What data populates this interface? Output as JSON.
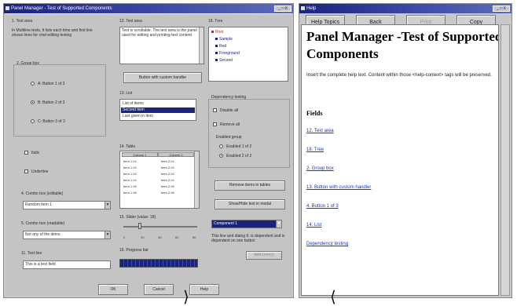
{
  "panel": {
    "title": "Panel Manager - Test of Supported Components",
    "controls": "_ □ X",
    "text_area_label": "1. Text area",
    "text_area_value": "In Multiline tests. It lists each time and first line shows lines for cmd editing testing",
    "groupbox_label": "2. Group box",
    "radios": [
      {
        "label": "A: Button 1 of 3",
        "selected": false
      },
      {
        "label": "B: Button 2 of 3",
        "selected": true
      },
      {
        "label": "C: Button 3 of 3",
        "selected": false
      }
    ],
    "check_italic": "Italic",
    "check_underline": "Underline",
    "combo_a_label": "4. Combo box (editable)",
    "combo_a_value": "Random item 1",
    "combo_b_label": "5. Combo box (readable)",
    "combo_b_value": "Not any of the items",
    "textline_label": "11. Text line",
    "textline_value": "This is a text field",
    "ok": "OK",
    "cancel": "Cancel",
    "help": "Help",
    "textarea2_label": "12. Text area",
    "textarea2_value": "Text is scrollable. The text area is the panel used for editing and printing text content",
    "button_custom": "Button with custom handler",
    "list_label": "13. List",
    "list_items": [
      {
        "label": "List of items",
        "selected": false
      },
      {
        "label": "Second item",
        "selected": true
      },
      {
        "label": "Last given in item",
        "selected": false
      }
    ],
    "table_label": "14. Table",
    "table_headers": [
      "Column 1",
      "Column 2"
    ],
    "table_rows": [
      [
        "Item 1.01",
        "Item 2.01"
      ],
      [
        "Item 1.02",
        "Item 2.02"
      ],
      [
        "Item 1.03",
        "Item 2.03"
      ],
      [
        "Item 1.04",
        "Item 2.04"
      ],
      [
        "Item 1.05",
        "Item 2.05"
      ],
      [
        "Item 1.06",
        "Item 2.06"
      ]
    ],
    "slider_label": "15. Slider (value: 18)",
    "slider_ticks": [
      "0",
      "20",
      "40",
      "60",
      "80"
    ],
    "slider_value": 18,
    "progress_label": "16. Progress bar",
    "progress_value": 100,
    "tree_label": "18. Tree",
    "tree_nodes": [
      "Root",
      "Sample",
      "Red",
      "Foreground",
      "Second"
    ],
    "dependency_label": "Dependency testing",
    "dep_check_1": "Disable all",
    "dep_check_2": "Remove all",
    "dep_group_label": "Enabled group",
    "dep_radios": [
      {
        "label": "Enabled 1 of 2",
        "selected": false
      },
      {
        "label": "Enabled 2 of 2",
        "selected": true
      }
    ],
    "dep_btn_1": "Remove items in tables",
    "dep_btn_2": "Show/Hide text in modal",
    "dep_combo_value": "Component 1",
    "dep_note": "This line and dialog 6: is dependent and is dependent on one button",
    "dep_btn_3": "Add Line(s)"
  },
  "help": {
    "title_bar": "Help",
    "controls": "_ □ X",
    "buttons": [
      "Help Topics",
      "Back",
      "Print",
      "Copy"
    ],
    "heading": "Panel Manager -Test of Supported Components",
    "description": "Insert the complete help text. Content within those <help-context> tags will be preserved.",
    "fields_heading": "Fields",
    "links": [
      "12. Text area",
      "18. Tree",
      "2. Group box",
      "13. Button with custom handler",
      "4. Button 1 of 3",
      "14. List",
      "Dependency testing"
    ]
  },
  "colors": {
    "title_bar": "#1a237e",
    "selection": "#1a237e",
    "link": "#1a33c8"
  }
}
